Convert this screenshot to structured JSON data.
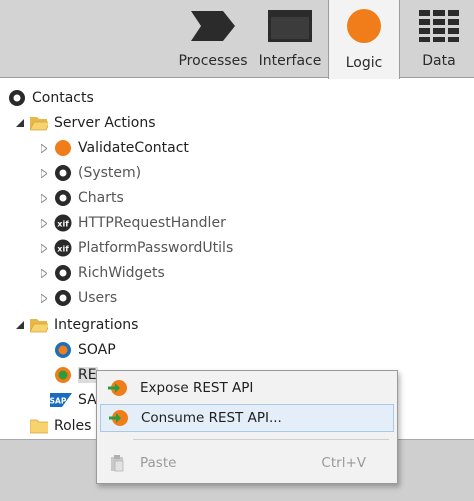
{
  "tabs": [
    {
      "label": "Processes",
      "icon": "process-arrow-icon",
      "active": false
    },
    {
      "label": "Interface",
      "icon": "window-icon",
      "active": false
    },
    {
      "label": "Logic",
      "icon": "orange-circle-icon",
      "active": true
    },
    {
      "label": "Data",
      "icon": "table-grid-icon",
      "active": false
    }
  ],
  "tree": {
    "root": "Contacts",
    "server_actions": {
      "label": "Server Actions",
      "items": [
        {
          "label": "ValidateContact",
          "icon": "orange-circle-icon"
        },
        {
          "label": "(System)",
          "icon": "module-dot-icon"
        },
        {
          "label": "Charts",
          "icon": "module-dot-icon"
        },
        {
          "label": "HTTPRequestHandler",
          "icon": "xif-icon"
        },
        {
          "label": "PlatformPasswordUtils",
          "icon": "xif-icon"
        },
        {
          "label": "RichWidgets",
          "icon": "module-dot-icon"
        },
        {
          "label": "Users",
          "icon": "module-dot-icon"
        }
      ]
    },
    "integrations": {
      "label": "Integrations",
      "items": [
        {
          "label": "SOAP",
          "icon": "soap-icon"
        },
        {
          "label": "REST",
          "icon": "rest-icon"
        },
        {
          "label": "SAP",
          "icon": "sap-icon"
        }
      ]
    },
    "roles": "Roles"
  },
  "context_menu": {
    "items": [
      {
        "label": "Expose REST API",
        "icon": "expose-rest-icon"
      },
      {
        "label": "Consume REST API...",
        "icon": "consume-rest-icon"
      },
      {
        "label": "Paste",
        "icon": "paste-icon",
        "shortcut": "Ctrl+V"
      }
    ]
  },
  "colors": {
    "accent_orange": "#f07d1a",
    "tab_strip": "#d3d3d3",
    "menu_highlight": "#e3eef8"
  }
}
